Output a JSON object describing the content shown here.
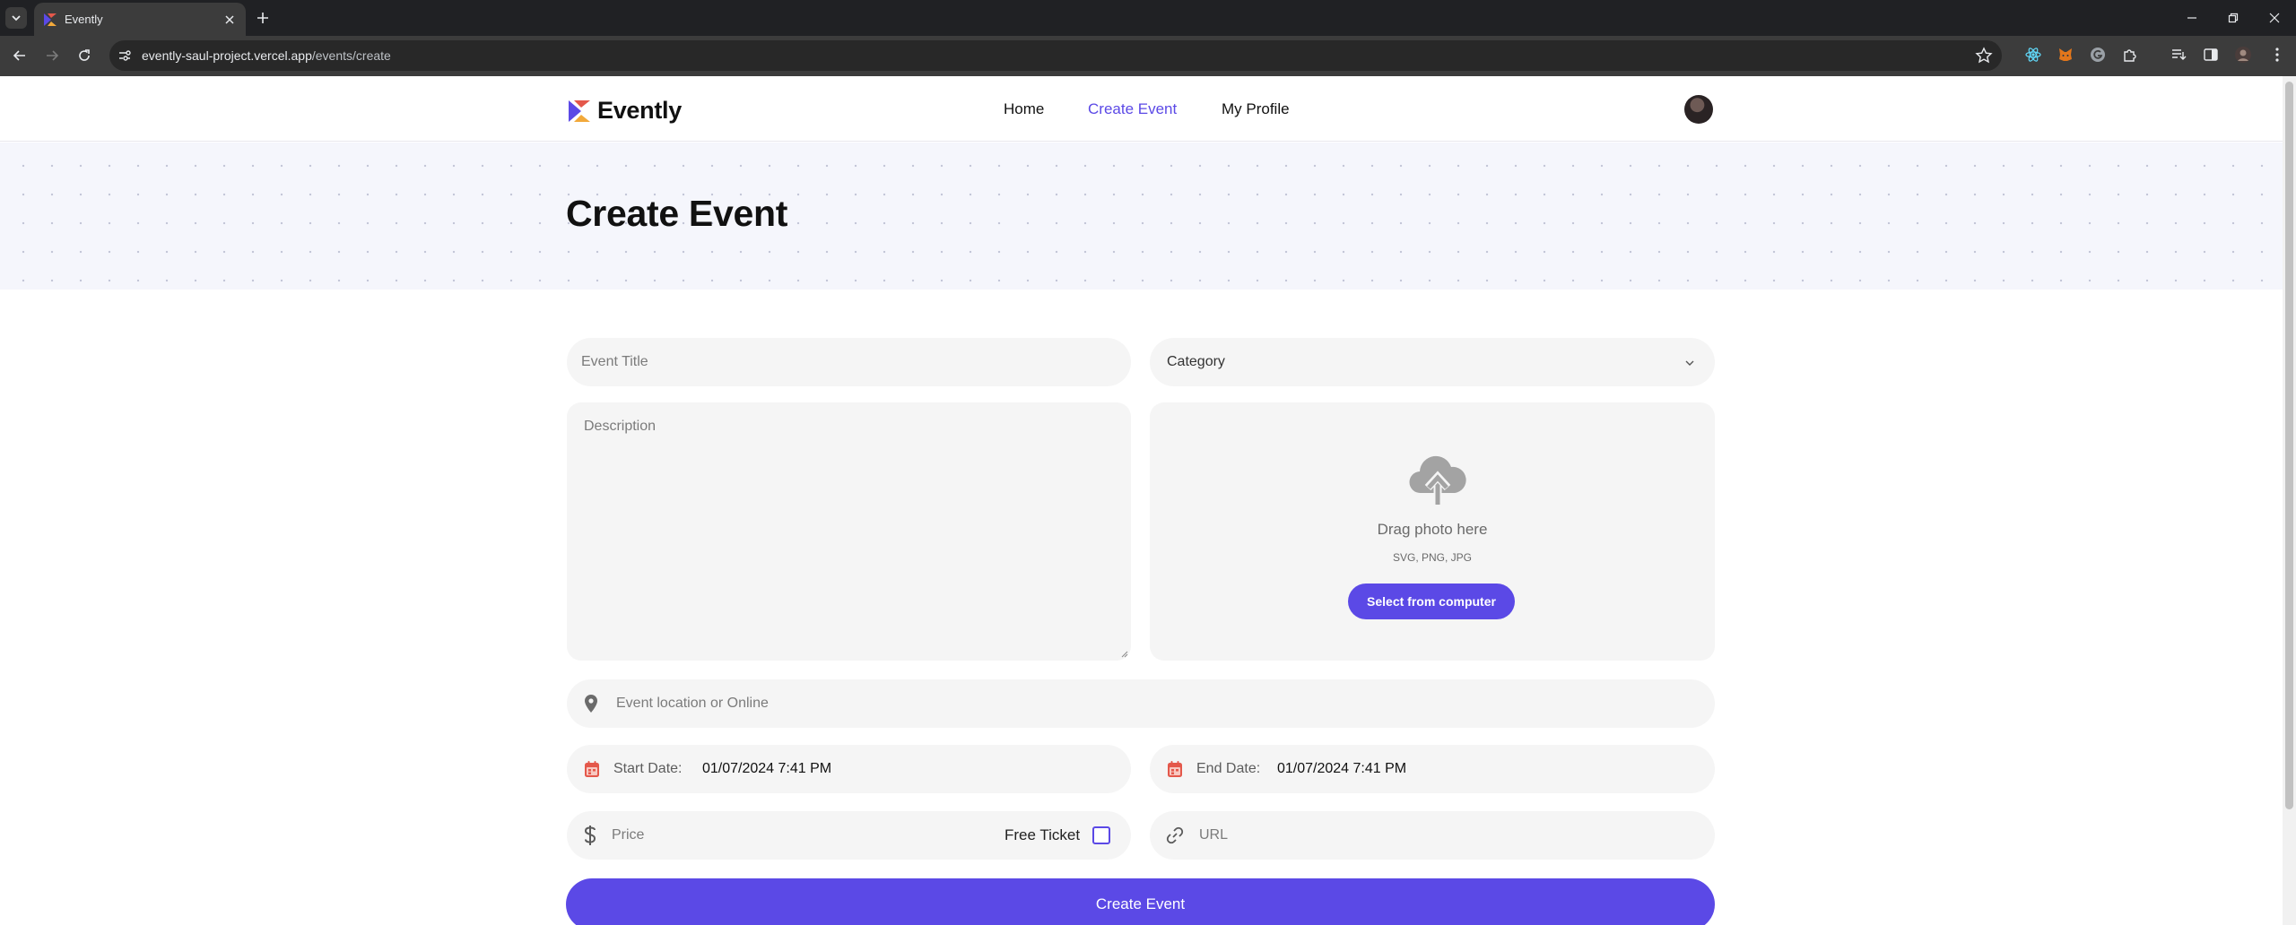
{
  "browser": {
    "tab_title": "Evently",
    "url_host": "evently-saul-project.vercel.app",
    "url_path": "/events/create"
  },
  "site": {
    "logo_text": "Evently",
    "nav": [
      "Home",
      "Create Event",
      "My Profile"
    ],
    "active_nav": "Create Event"
  },
  "page_title": "Create Event",
  "form": {
    "title_placeholder": "Event Title",
    "category_placeholder": "Category",
    "description_placeholder": "Description",
    "upload": {
      "drag_text": "Drag photo here",
      "types_text": "SVG, PNG, JPG",
      "button_label": "Select from computer"
    },
    "location_placeholder": "Event location or Online",
    "start_label": "Start Date:",
    "start_value": "01/07/2024 7:41 PM",
    "end_label": "End Date:",
    "end_value": "01/07/2024 7:41 PM",
    "price_placeholder": "Price",
    "free_ticket_label": "Free Ticket",
    "free_ticket_checked": false,
    "url_placeholder": "URL",
    "submit_label": "Create Event"
  },
  "colors": {
    "brand": "#5b49e6",
    "field_bg": "#f5f5f5",
    "date_icon": "#e4584b"
  }
}
